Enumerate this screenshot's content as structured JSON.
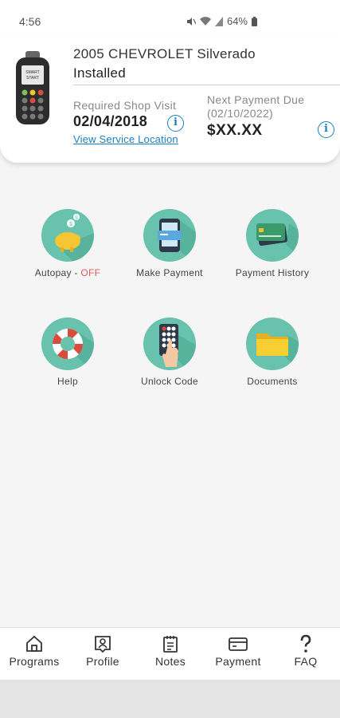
{
  "status_bar": {
    "time": "4:56",
    "battery": "64%"
  },
  "vehicle": {
    "name": "2005 CHEVROLET Silverado",
    "status": "Installed",
    "device_screen_text": [
      "SMART",
      "START"
    ]
  },
  "shop_visit": {
    "label": "Required Shop Visit",
    "date": "02/04/2018",
    "link": "View Service Location"
  },
  "payment": {
    "label_line1": "Next Payment Due",
    "label_line2": "(02/10/2022)",
    "amount": "$XX.XX"
  },
  "tiles": {
    "autopay": {
      "label": "Autopay",
      "separator": " - ",
      "state": "OFF"
    },
    "make_payment": {
      "label": "Make Payment"
    },
    "payment_history": {
      "label": "Payment History"
    },
    "help": {
      "label": "Help"
    },
    "unlock_code": {
      "label": "Unlock Code"
    },
    "documents": {
      "label": "Documents"
    }
  },
  "nav": {
    "programs": "Programs",
    "profile": "Profile",
    "notes": "Notes",
    "payment": "Payment",
    "faq": "FAQ"
  },
  "colors": {
    "accent": "#1a7fc1",
    "tile_bg": "#68c2ad",
    "off": "#e05a5a"
  }
}
